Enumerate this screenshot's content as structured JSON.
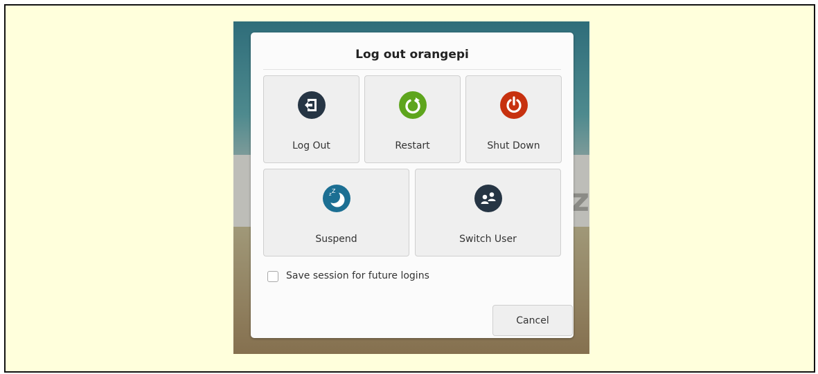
{
  "dialog": {
    "title": "Log out orangepi"
  },
  "actions": [
    {
      "label": "Log Out",
      "icon": "log-out-icon",
      "color": "#263544"
    },
    {
      "label": "Restart",
      "icon": "restart-icon",
      "color": "#5ea51d"
    },
    {
      "label": "Shut Down",
      "icon": "power-icon",
      "color": "#c7310f"
    },
    {
      "label": "Suspend",
      "icon": "suspend-moon-icon",
      "color": "#1c6f93"
    },
    {
      "label": "Switch User",
      "icon": "switch-user-icon",
      "color": "#263544"
    }
  ],
  "options": {
    "save_session_label": "Save session for future logins",
    "save_session_checked": false
  },
  "footer": {
    "cancel_label": "Cancel"
  }
}
